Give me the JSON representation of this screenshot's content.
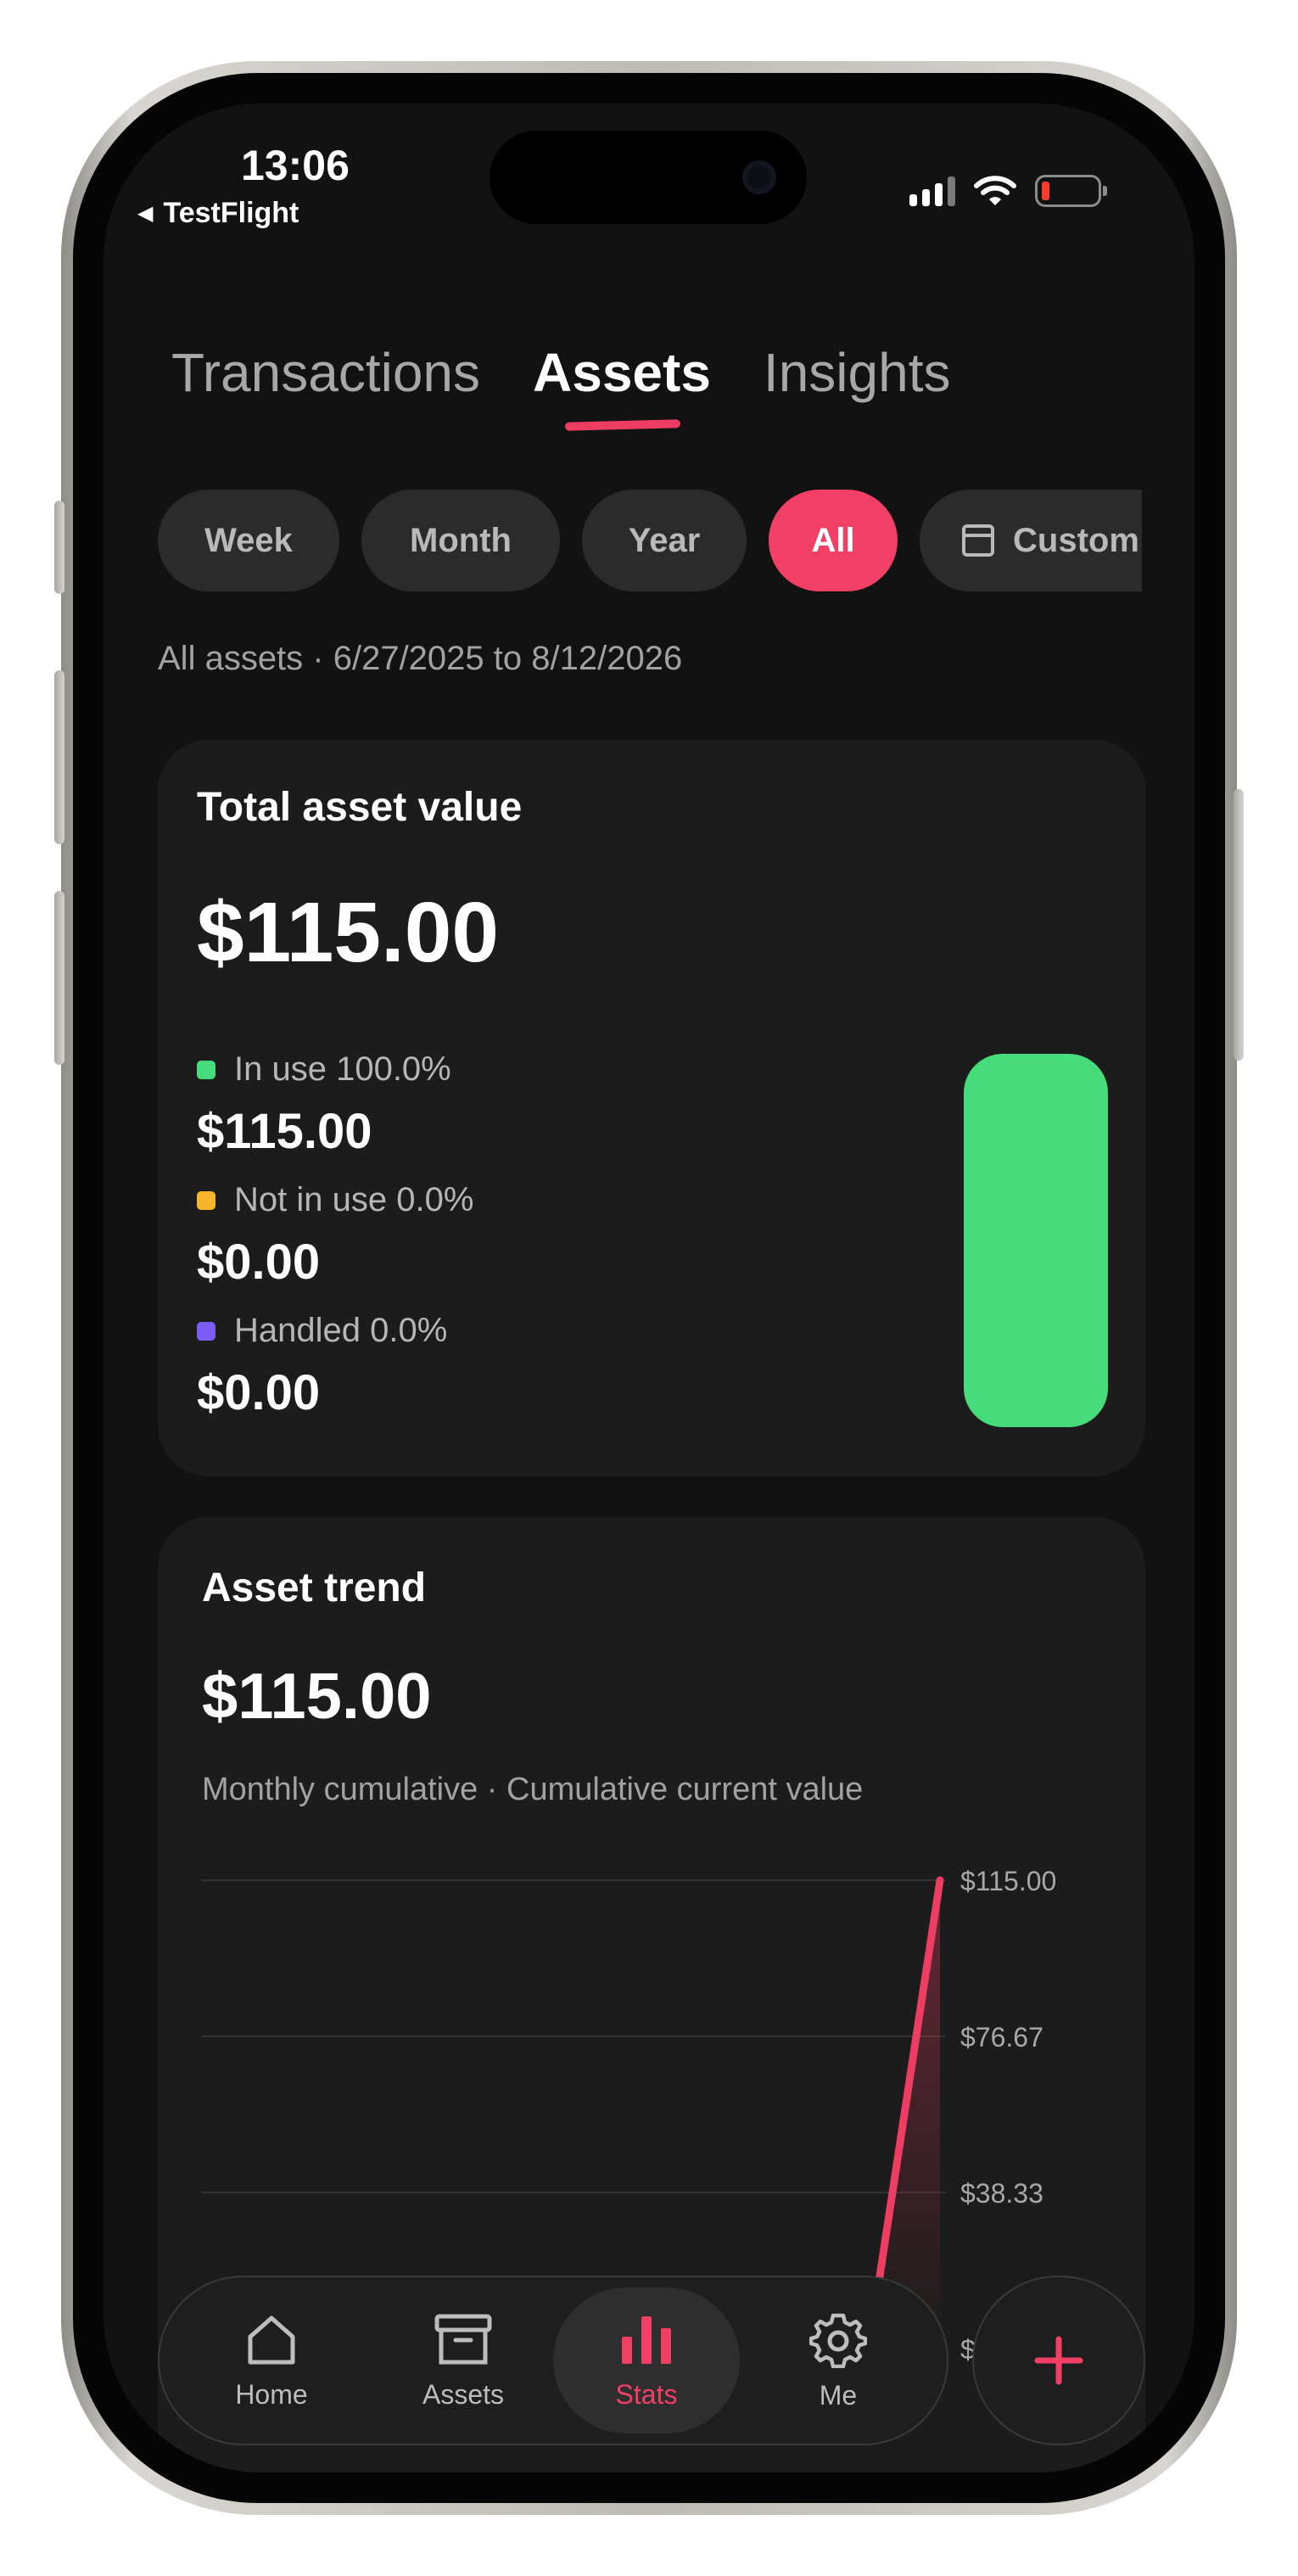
{
  "status_bar": {
    "time": "13:06",
    "back_label": "TestFlight"
  },
  "tabs": [
    {
      "label": "Transactions",
      "active": false
    },
    {
      "label": "Assets",
      "active": true
    },
    {
      "label": "Insights",
      "active": false
    }
  ],
  "filters": {
    "options": [
      "Week",
      "Month",
      "Year",
      "All",
      "Custom"
    ],
    "selected": "All"
  },
  "range_text": "All assets · 6/27/2025 to 8/12/2026",
  "total_card": {
    "title": "Total asset value",
    "value": "$115.00",
    "legend": [
      {
        "label": "In use 100.0%",
        "value": "$115.00",
        "color": "#47dc7b"
      },
      {
        "label": "Not in use 0.0%",
        "value": "$0.00",
        "color": "#f7b52c"
      },
      {
        "label": "Handled 0.0%",
        "value": "$0.00",
        "color": "#7d5cf5"
      }
    ],
    "bar_fraction_in_use": 1.0
  },
  "trend_card": {
    "title": "Asset trend",
    "value": "$115.00",
    "subtitle": "Monthly cumulative · Cumulative current value",
    "y_tick_labels": [
      "$115.00",
      "$76.67",
      "$38.33",
      "$"
    ]
  },
  "chart_data": {
    "type": "line",
    "title": "Asset trend",
    "yticks": [
      115.0,
      76.67,
      38.33,
      0
    ],
    "ylim": [
      0,
      115
    ],
    "series": [
      {
        "values": [
          0,
          115
        ]
      }
    ],
    "color": "#ee3d62"
  },
  "nav": {
    "items": [
      {
        "label": "Home",
        "icon": "home-icon"
      },
      {
        "label": "Assets",
        "icon": "archive-icon"
      },
      {
        "label": "Stats",
        "icon": "bar-chart-icon"
      },
      {
        "label": "Me",
        "icon": "gear-icon"
      }
    ],
    "active": "Stats",
    "fab_icon": "plus-icon"
  },
  "colors": {
    "accent": "#f23f65",
    "background": "#121212",
    "card": "#1c1c1c"
  }
}
